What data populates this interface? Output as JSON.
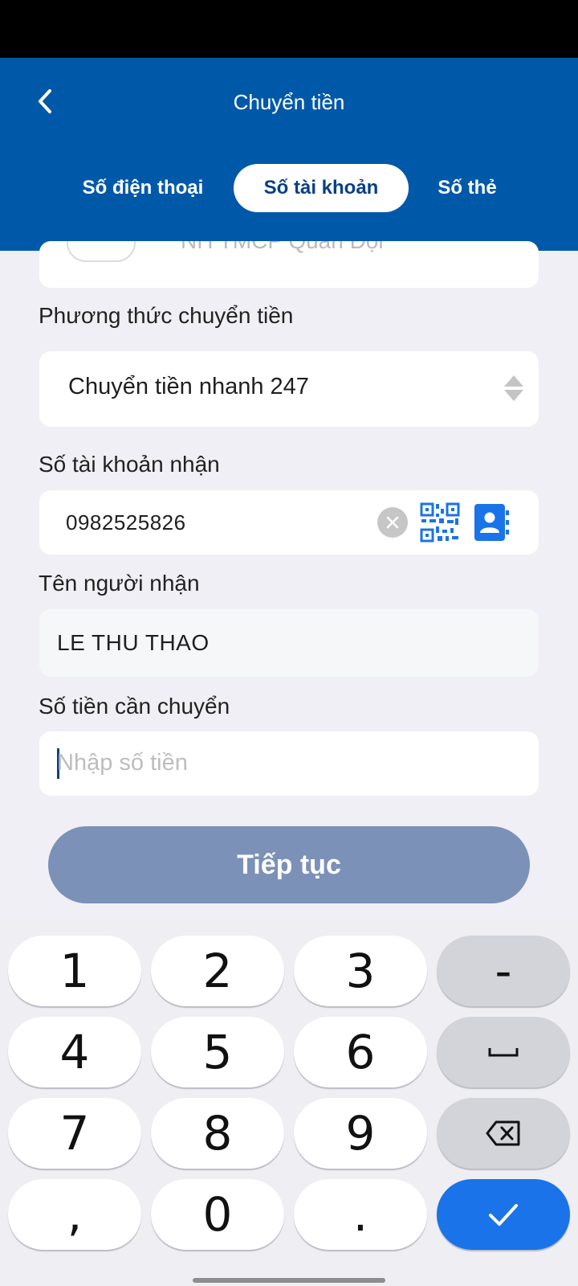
{
  "header": {
    "title": "Chuyển tiền",
    "tabs": [
      {
        "label": "Số điện thoại",
        "active": false
      },
      {
        "label": "Số tài khoản",
        "active": true
      },
      {
        "label": "Số thẻ",
        "active": false
      }
    ]
  },
  "form": {
    "bank_partial": "NH TMCP Quân Đội",
    "method_label": "Phương thức chuyển tiền",
    "method_value": "Chuyển tiền nhanh 247",
    "account_label": "Số tài khoản nhận",
    "account_value": "0982525826",
    "recipient_label": "Tên người nhận",
    "recipient_value": "LE THU THAO",
    "amount_label": "Số tiền cần chuyển",
    "amount_placeholder": "Nhập số tiền",
    "continue_label": "Tiếp tục"
  },
  "keyboard": {
    "rows": [
      [
        "1",
        "2",
        "3",
        "-"
      ],
      [
        "4",
        "5",
        "6",
        "space-icon"
      ],
      [
        "7",
        "8",
        "9",
        "backspace-icon"
      ],
      [
        ",",
        "0",
        ".",
        "check-icon"
      ]
    ]
  },
  "colors": {
    "header": "#0059a8",
    "accent": "#1a73e8",
    "button_disabled": "#7b91b7"
  }
}
